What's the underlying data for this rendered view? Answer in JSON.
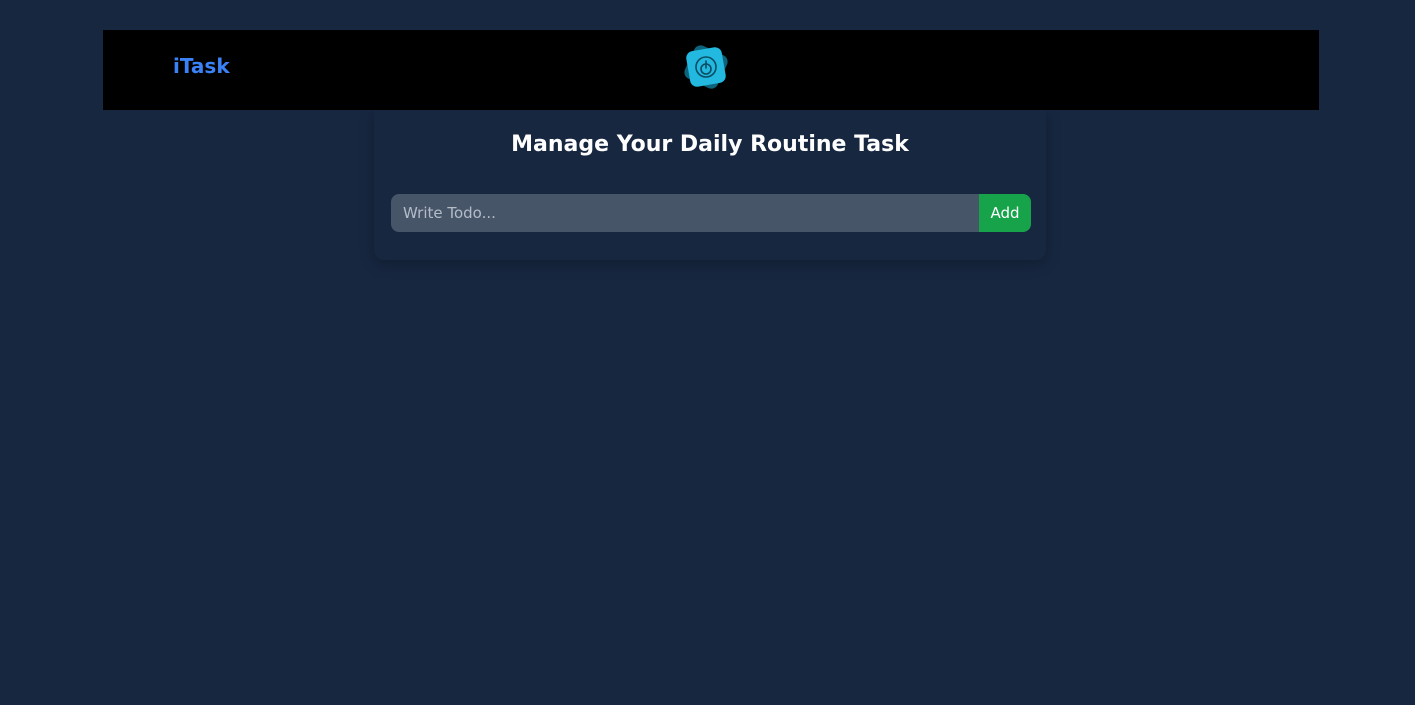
{
  "navbar": {
    "brand": "iTask",
    "logo_icon": "power-icon"
  },
  "main": {
    "title": "Manage Your Daily Routine Task",
    "todo_input": {
      "value": "",
      "placeholder": "Write Todo..."
    },
    "add_label": "Add"
  },
  "colors": {
    "page_bg": "#172740",
    "navbar_bg": "#000000",
    "brand": "#3b82f6",
    "logo": "#22b8e0",
    "input_bg": "#475569",
    "add_button": "#16a34a"
  }
}
